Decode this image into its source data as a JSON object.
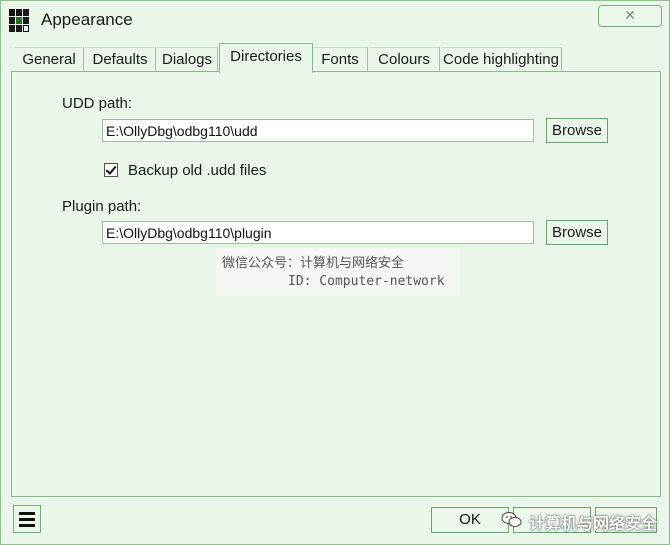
{
  "window": {
    "title": "Appearance",
    "close_glyph": "✕"
  },
  "tabs": [
    {
      "label": "General"
    },
    {
      "label": "Defaults"
    },
    {
      "label": "Dialogs"
    },
    {
      "label": "Directories"
    },
    {
      "label": "Fonts"
    },
    {
      "label": "Colours"
    },
    {
      "label": "Code highlighting"
    }
  ],
  "active_tab": "Directories",
  "udd": {
    "label": "UDD path:",
    "value": "E:\\OllyDbg\\odbg110\\udd",
    "browse_label": "Browse",
    "backup_label": "Backup old .udd files",
    "backup_checked": true
  },
  "plugin": {
    "label": "Plugin path:",
    "value": "E:\\OllyDbg\\odbg110\\plugin",
    "browse_label": "Browse"
  },
  "watermark": {
    "line1": "微信公众号：计算机与网络安全",
    "line2": "ID: Computer-network",
    "footer": "计算机与网络安全"
  },
  "footer": {
    "ok_label": "OK"
  },
  "icons": {
    "app": "grid-app-icon",
    "menu": "list-menu-icon",
    "wechat": "wechat-icon"
  },
  "colors": {
    "background": "#eaf6ea",
    "border": "#8fb58f"
  }
}
